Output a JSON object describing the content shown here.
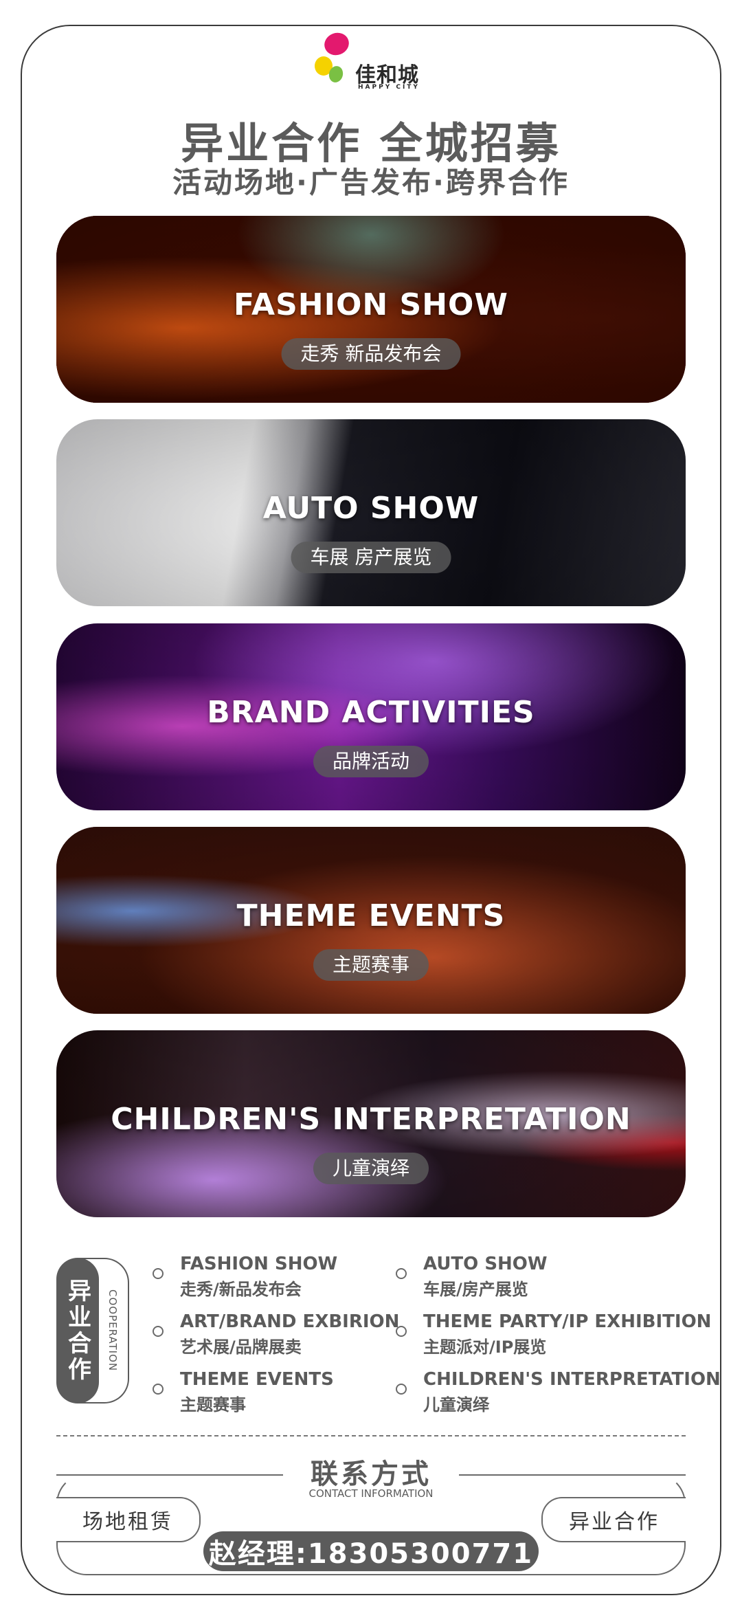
{
  "logo": {
    "name": "佳和城",
    "subtitle": "HAPPY CITY",
    "colors": [
      "#e3196e",
      "#f5d200",
      "#7ac043"
    ]
  },
  "headline": {
    "line1": "异业合作  全城招募",
    "line2": "活动场地·广告发布·跨界合作"
  },
  "cards": [
    {
      "title": "FASHION SHOW",
      "subtitle": "走秀  新品发布会"
    },
    {
      "title": "AUTO SHOW",
      "subtitle": "车展  房产展览"
    },
    {
      "title": "BRAND ACTIVITIES",
      "subtitle": "品牌活动"
    },
    {
      "title": "THEME EVENTS",
      "subtitle": "主题赛事"
    },
    {
      "title": "CHILDREN'S INTERPRETATION",
      "subtitle": "儿童演绎"
    }
  ],
  "cooperation": {
    "label_zh": "异业合作",
    "label_en": "COOPERATION",
    "items": [
      {
        "en": "FASHION SHOW",
        "zh": "走秀/新品发布会"
      },
      {
        "en": "AUTO SHOW",
        "zh": "车展/房产展览"
      },
      {
        "en": "ART/BRAND EXBIRION",
        "zh": "艺术展/品牌展卖"
      },
      {
        "en": "THEME PARTY/IP EXHIBITION",
        "zh": "主题派对/IP展览"
      },
      {
        "en": "THEME EVENTS",
        "zh": "主题赛事"
      },
      {
        "en": "CHILDREN'S INTERPRETATION",
        "zh": "儿童演绎"
      }
    ]
  },
  "contact": {
    "title": "联系方式",
    "subtitle": "CONTACT INFORMATION",
    "tag_left": "场地租赁",
    "tag_right": "异业合作",
    "phone": "赵经理:18305300771"
  }
}
